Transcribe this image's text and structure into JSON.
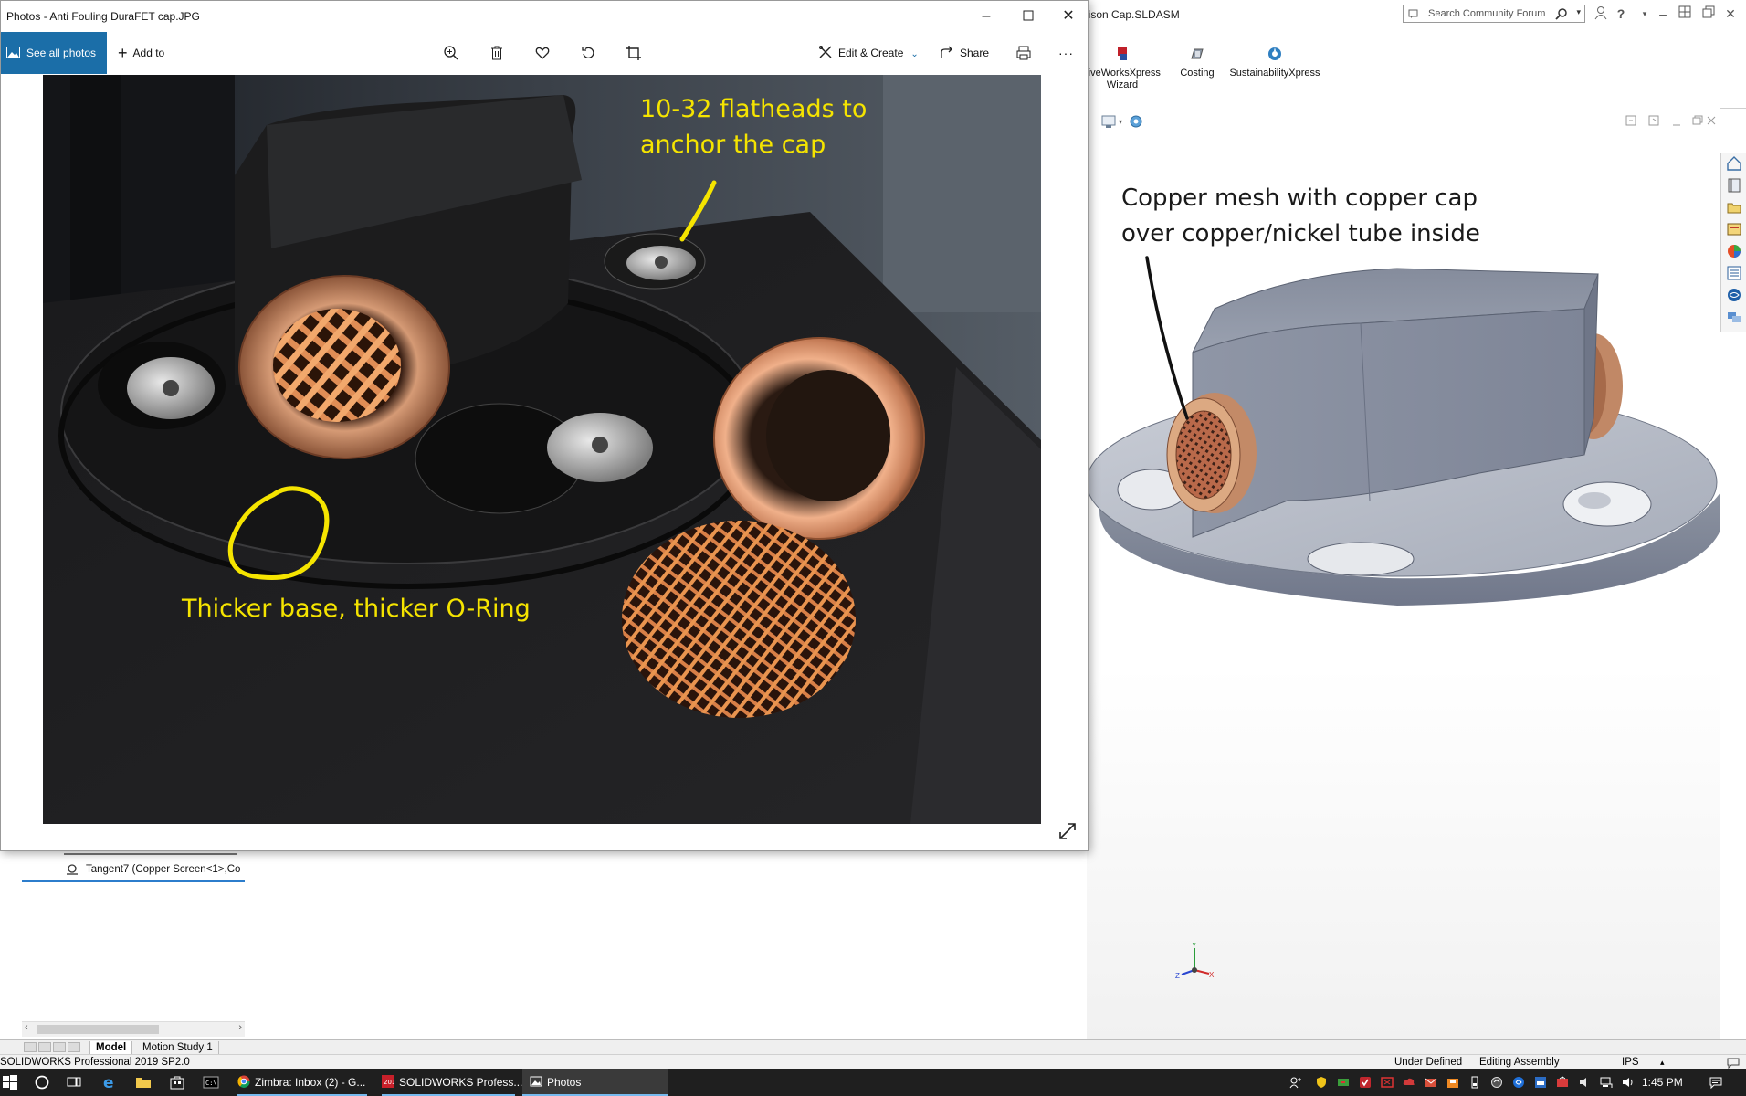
{
  "solidworks": {
    "doc_title": "bison Cap.SLDASM",
    "search_placeholder": "Search Community Forum",
    "ribbon": [
      {
        "label_line1": "riveWorksXpress",
        "label_line2": "Wizard"
      },
      {
        "label_line1": "Costing",
        "label_line2": ""
      },
      {
        "label_line1": "SustainabilityXpress",
        "label_line2": ""
      }
    ],
    "tree_items": [
      "Tangent7 (Copper Screen<1>,Co"
    ],
    "tabs": {
      "model": "Model",
      "motion": "Motion Study 1"
    },
    "status": {
      "product": "SOLIDWORKS Professional 2019 SP2.0",
      "defined": "Under Defined",
      "mode": "Editing Assembly",
      "units": "IPS"
    },
    "viewport_annotation": {
      "line1": "Copper mesh with copper cap",
      "line2": "over copper/nickel tube inside"
    },
    "triad": {
      "y": "Y",
      "z": "Z",
      "x": "X"
    }
  },
  "photos": {
    "title": "Photos - Anti Fouling DuraFET cap.JPG",
    "see_all": "See all photos",
    "add_to": "Add to",
    "edit_create": "Edit & Create",
    "share": "Share",
    "more": "···",
    "annotations": {
      "flatheads_line1": "10-32 flatheads to",
      "flatheads_line2": "anchor the cap",
      "base": "Thicker base, thicker O-Ring"
    }
  },
  "taskbar": {
    "apps": [
      {
        "label": "Zimbra: Inbox (2) - G..."
      },
      {
        "label": "SOLIDWORKS Profess..."
      },
      {
        "label": "Photos"
      }
    ],
    "clock": "1:45 PM"
  },
  "colors": {
    "photos_accent": "#1b6ea8",
    "annotation_yellow": "#f5e400",
    "taskbar": "#1f1f1f",
    "model_gray": "#9aa0ad",
    "copper": "#c8906a"
  }
}
